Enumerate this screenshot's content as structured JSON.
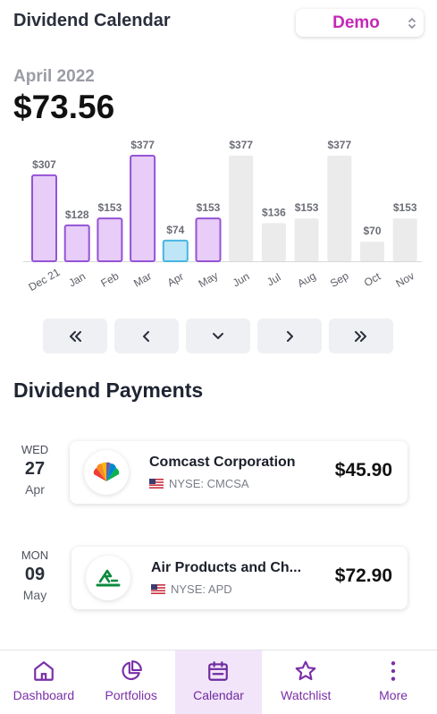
{
  "header": {
    "title": "Dividend Calendar",
    "portfolio_value": "Demo"
  },
  "summary": {
    "month": "April 2022",
    "total": "$73.56"
  },
  "chart_data": {
    "type": "bar",
    "categories": [
      "Dec 21",
      "Jan",
      "Feb",
      "Mar",
      "Apr",
      "May",
      "Jun",
      "Jul",
      "Aug",
      "Sep",
      "Oct",
      "Nov"
    ],
    "values": [
      307,
      128,
      153,
      377,
      74,
      153,
      377,
      136,
      153,
      377,
      70,
      153
    ],
    "value_labels": [
      "$307",
      "$128",
      "$153",
      "$377",
      "$74",
      "$153",
      "$377",
      "$136",
      "$153",
      "$377",
      "$70",
      "$153"
    ],
    "status": [
      "past",
      "past",
      "past",
      "past",
      "current",
      "past",
      "future",
      "future",
      "future",
      "future",
      "future",
      "future"
    ],
    "ylim": [
      0,
      377
    ],
    "grid": false,
    "colors": {
      "past_fill": "#e7cdf7",
      "past_stroke": "#9553d6",
      "current_fill": "#bfe6f7",
      "current_stroke": "#48b5e0",
      "future_fill": "#ebebeb"
    }
  },
  "navigation": {
    "buttons": [
      {
        "icon": "double-chevron-left-icon"
      },
      {
        "icon": "chevron-left-icon"
      },
      {
        "icon": "chevron-down-icon"
      },
      {
        "icon": "chevron-right-icon"
      },
      {
        "icon": "double-chevron-right-icon"
      }
    ]
  },
  "payments": {
    "title": "Dividend Payments",
    "items": [
      {
        "weekday": "WED",
        "day": "27",
        "month": "Apr",
        "company": "Comcast Corporation",
        "exchange": "NYSE: CMCSA",
        "amount": "$45.90",
        "logo": "nbc-peacock-icon"
      },
      {
        "weekday": "MON",
        "day": "09",
        "month": "May",
        "company": "Air Products and Ch...",
        "exchange": "NYSE: APD",
        "amount": "$72.90",
        "logo": "air-products-logo-icon"
      }
    ]
  },
  "tabbar": {
    "tabs": [
      {
        "label": "Dashboard",
        "icon": "home-icon",
        "active": false
      },
      {
        "label": "Portfolios",
        "icon": "pie-chart-icon",
        "active": false
      },
      {
        "label": "Calendar",
        "icon": "calendar-icon",
        "active": true
      },
      {
        "label": "Watchlist",
        "icon": "star-icon",
        "active": false
      },
      {
        "label": "More",
        "icon": "more-vertical-icon",
        "active": false
      }
    ]
  },
  "colors": {
    "accent": "#7a2fa8",
    "brand_pink": "#c428b6"
  }
}
